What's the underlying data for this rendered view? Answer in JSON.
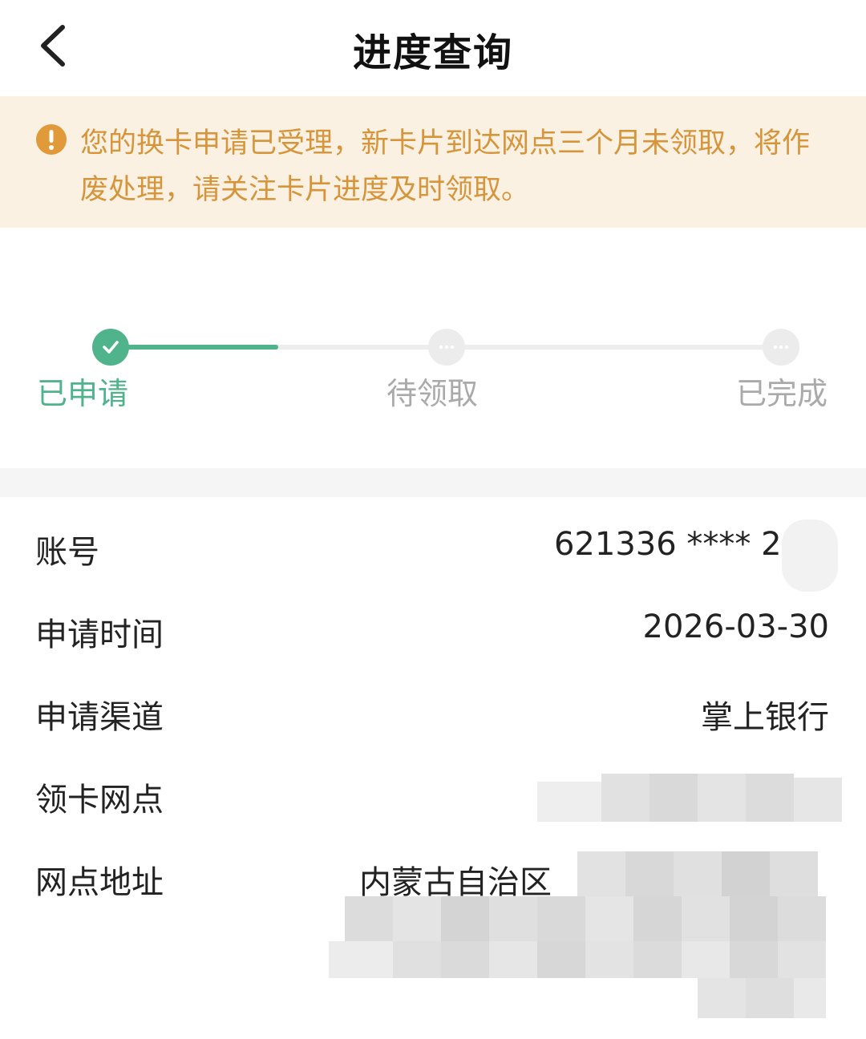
{
  "header": {
    "title": "进度查询",
    "back_icon": "chevron-left-icon"
  },
  "notice": {
    "icon": "exclamation-circle-icon",
    "icon_color": "#e09a3a",
    "text": "您的换卡申请已受理，新卡片到达网点三个月未领取，将作废处理，请关注卡片进度及时领取。"
  },
  "stepper": {
    "progress": 0.25,
    "accent_color": "#4fb38c",
    "steps": [
      {
        "label": "已申请",
        "state": "done",
        "icon": "check-icon"
      },
      {
        "label": "待领取",
        "state": "pending",
        "icon": "ellipsis-icon"
      },
      {
        "label": "已完成",
        "state": "pending",
        "icon": "ellipsis-icon"
      }
    ]
  },
  "details": {
    "rows": [
      {
        "label": "账号",
        "value": "621336 **** 21"
      },
      {
        "label": "申请时间",
        "value": "2026-03-30"
      },
      {
        "label": "申请渠道",
        "value": "掌上银行"
      },
      {
        "label": "领卡网点",
        "value": ""
      },
      {
        "label": "网点地址",
        "value": "内蒙古自治区"
      }
    ]
  }
}
